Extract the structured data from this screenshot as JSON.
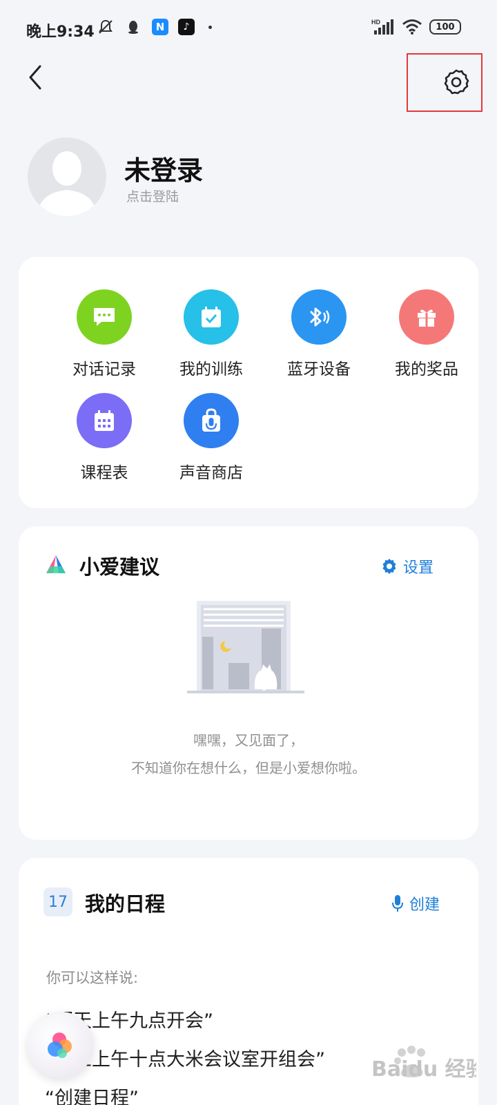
{
  "status_bar": {
    "time": "晚上9:34",
    "app_n": "N",
    "app_t": "♪",
    "battery": "100",
    "network": "HD"
  },
  "profile": {
    "name": "未登录",
    "subtitle": "点击登陆"
  },
  "features": [
    {
      "label": "对话记录",
      "icon": "chat-bubble-icon",
      "color": "#7ed321"
    },
    {
      "label": "我的训练",
      "icon": "calendar-check-icon",
      "color": "#26c0e8"
    },
    {
      "label": "蓝牙设备",
      "icon": "bluetooth-icon",
      "color": "#2b95f2"
    },
    {
      "label": "我的奖品",
      "icon": "gift-icon",
      "color": "#f57878"
    },
    {
      "label": "课程表",
      "icon": "calendar-grid-icon",
      "color": "#7b6df5"
    },
    {
      "label": "声音商店",
      "icon": "shopping-bag-mic-icon",
      "color": "#2f7ff0"
    }
  ],
  "suggestion": {
    "title": "小爱建议",
    "action": "设置",
    "empty_line1": "嘿嘿，又见面了，",
    "empty_line2": "不知道你在想什么，但是小爱想你啦。"
  },
  "schedule": {
    "badge": "17",
    "title": "我的日程",
    "action": "创建",
    "hint": "你可以这样说:",
    "examples": [
      "“明天上午九点开会”",
      "“周五上午十点大米会议室开组会”",
      "“创建日程”"
    ]
  },
  "watermark": "Baidu 经验",
  "colors": {
    "accent": "#1f7fd8",
    "highlight": "#e03a3a",
    "background": "#f4f5f9"
  }
}
